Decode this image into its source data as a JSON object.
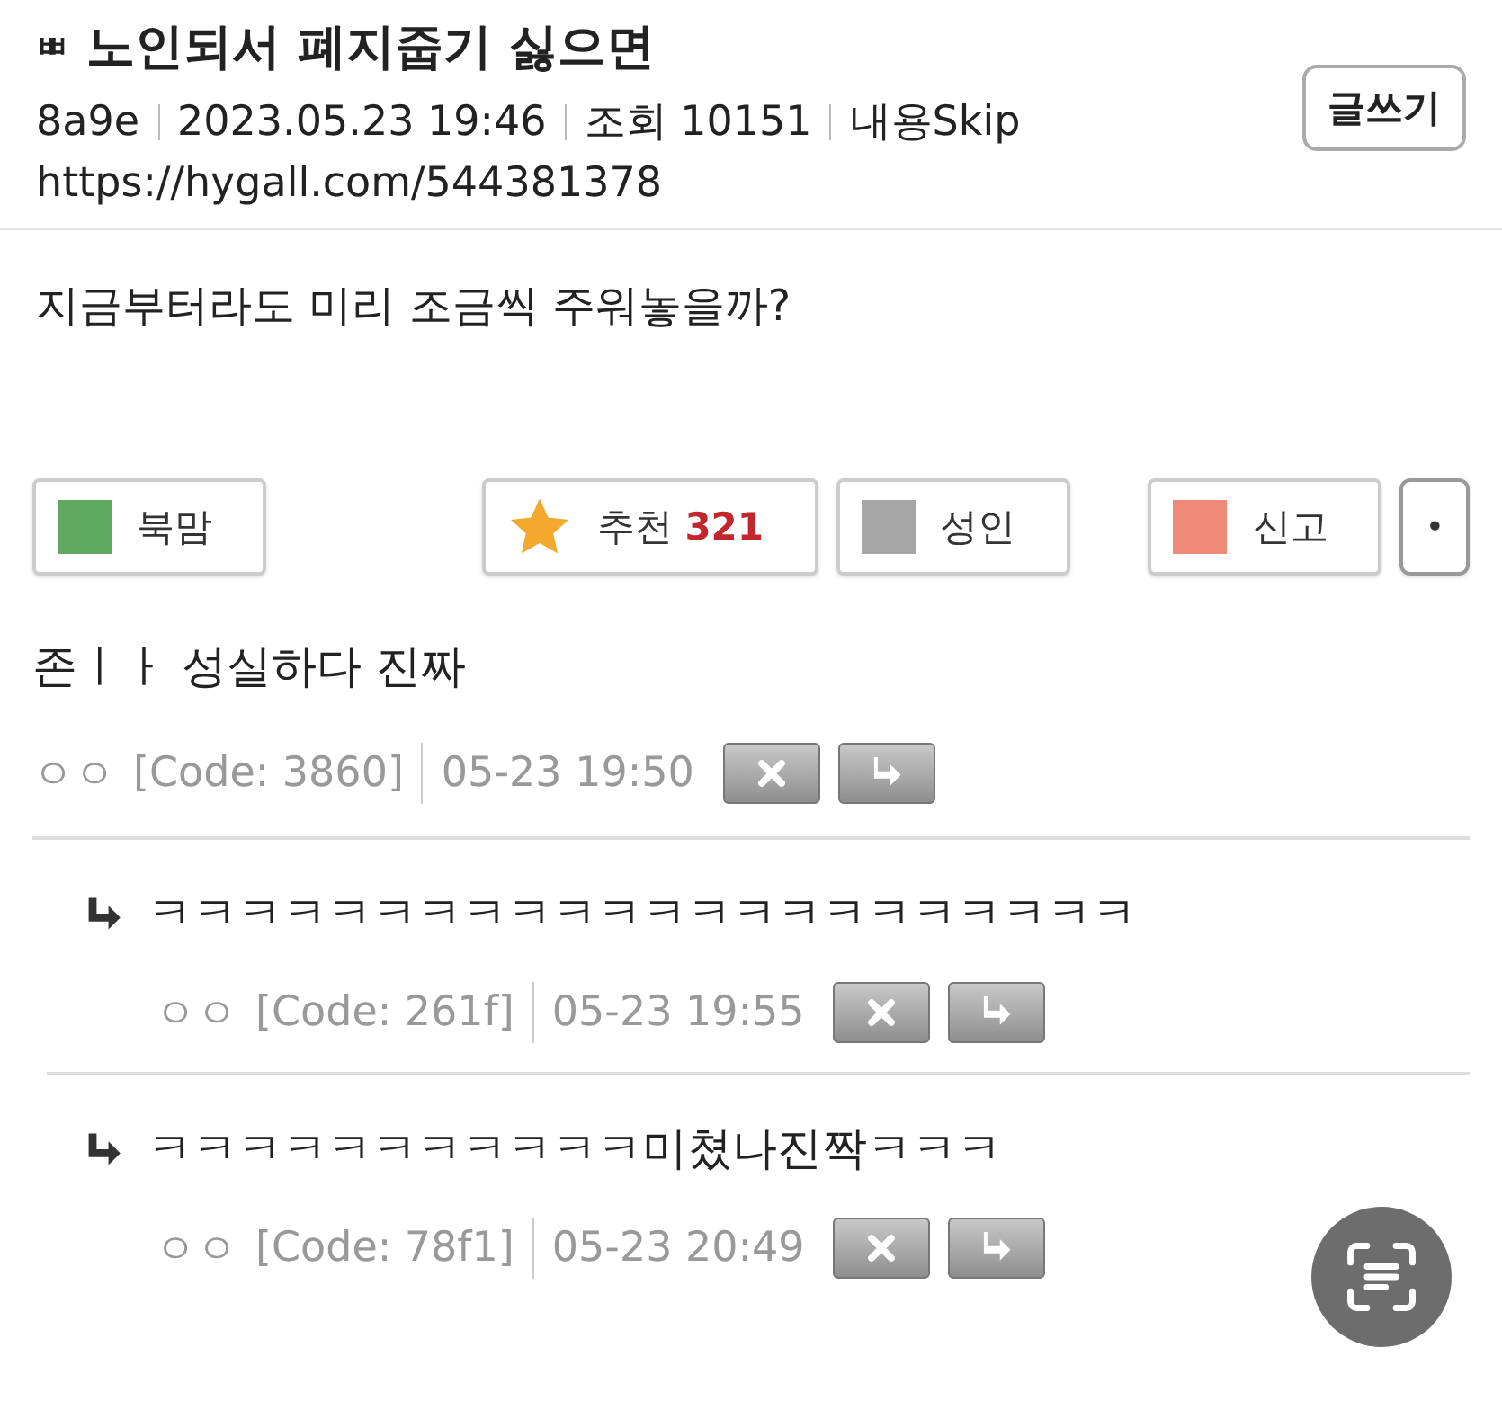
{
  "post": {
    "badge": "ㅃ",
    "title": "노인되서 폐지줍기 싫으면",
    "author": "8a9e",
    "date": "2023.05.23 19:46",
    "views": "조회 10151",
    "skip": "내용Skip",
    "url": "https://hygall.com/544381378",
    "write_button": "글쓰기",
    "body": "지금부터라도 미리 조금씩 주워놓을까?"
  },
  "actions": [
    {
      "kind": "square",
      "label": "북맘",
      "color": "#5fa85f"
    },
    {
      "kind": "star",
      "label": "추천",
      "count": "321"
    },
    {
      "kind": "square",
      "label": "성인",
      "color": "#a6a6a6"
    },
    {
      "kind": "square",
      "label": "신고",
      "color": "#ef8a78"
    },
    {
      "kind": "dot",
      "label": "•"
    }
  ],
  "comments": [
    {
      "text": "존ㅣㅏ 성실하다 진짜",
      "author": "ㅇㅇ",
      "code": "[Code: 3860]",
      "time": "05-23 19:50",
      "children": [
        {
          "text": "ㅋㅋㅋㅋㅋㅋㅋㅋㅋㅋㅋㅋㅋㅋㅋㅋㅋㅋㅋㅋㅋㅋ",
          "author": "ㅇㅇ",
          "code": "[Code: 261f]",
          "time": "05-23 19:55"
        },
        {
          "text": "ㅋㅋㅋㅋㅋㅋㅋㅋㅋㅋㅋ미쳤나진짝ㅋㅋㅋ",
          "author": "ㅇㅇ",
          "code": "[Code: 78f1]",
          "time": "05-23 20:49"
        }
      ]
    }
  ]
}
